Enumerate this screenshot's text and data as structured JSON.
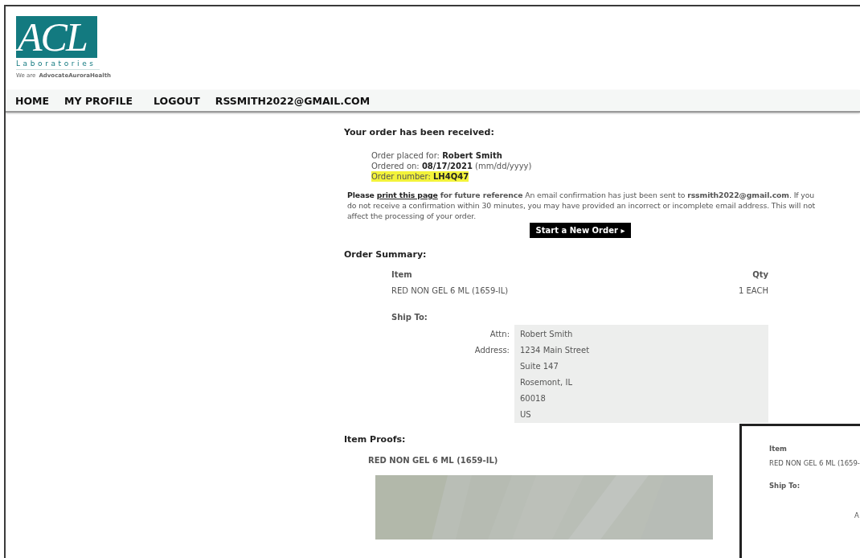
{
  "logo": {
    "letters": "ACL",
    "name": "Laboratories",
    "tagline": "We are",
    "partner": "AdvocateAuroraHealth"
  },
  "nav": [
    "HOME",
    "MY PROFILE",
    "LOGOUT",
    "RSSMITH2022@GMAIL.COM"
  ],
  "confirmation": {
    "heading": "Your order has been received:",
    "details": [
      {
        "label": "Order placed for:",
        "value": "Robert Smith",
        "highlighted": false
      },
      {
        "label": "Ordered on:",
        "value": "08/17/2021",
        "note": "(mm/dd/yyyy)",
        "highlighted": false
      },
      {
        "label": "Order number:",
        "value": "LH4Q47",
        "highlighted": true
      }
    ],
    "message_lead": "Please",
    "print_link": "print this page",
    "message": "**for future reference** An email confirmation has just been sent to **rssmith2022@gmail.com**. If you do not receive a confirmation within 30 minutes, you may have provided an incorrect or incomplete email address. This will not affect the processing of your order.",
    "button": "Start a New Order",
    "button_icon": "▸"
  },
  "summary": {
    "heading": "Order Summary:",
    "columns": [
      "Item",
      "Qty"
    ],
    "rows": [
      {
        "item": "RED NON GEL 6 ML (1659-IL)",
        "qty": "1 EACH"
      }
    ],
    "ship_heading": "Ship To:",
    "ship": [
      {
        "label": "Attn:",
        "lines": [
          "Robert Smith"
        ]
      },
      {
        "label": "Address:",
        "lines": [
          "1234 Main Street",
          "Suite 147",
          "Rosemont, IL",
          "60018",
          "US"
        ]
      }
    ]
  },
  "proofs": {
    "heading": "Item Proofs:",
    "item": "RED NON GEL 6 ML (1659-IL)"
  },
  "overlay": {
    "item_heading": "Item",
    "item": "RED NON GEL 6 ML (1659-",
    "ship_heading": "Ship To:",
    "address_label": "A"
  }
}
